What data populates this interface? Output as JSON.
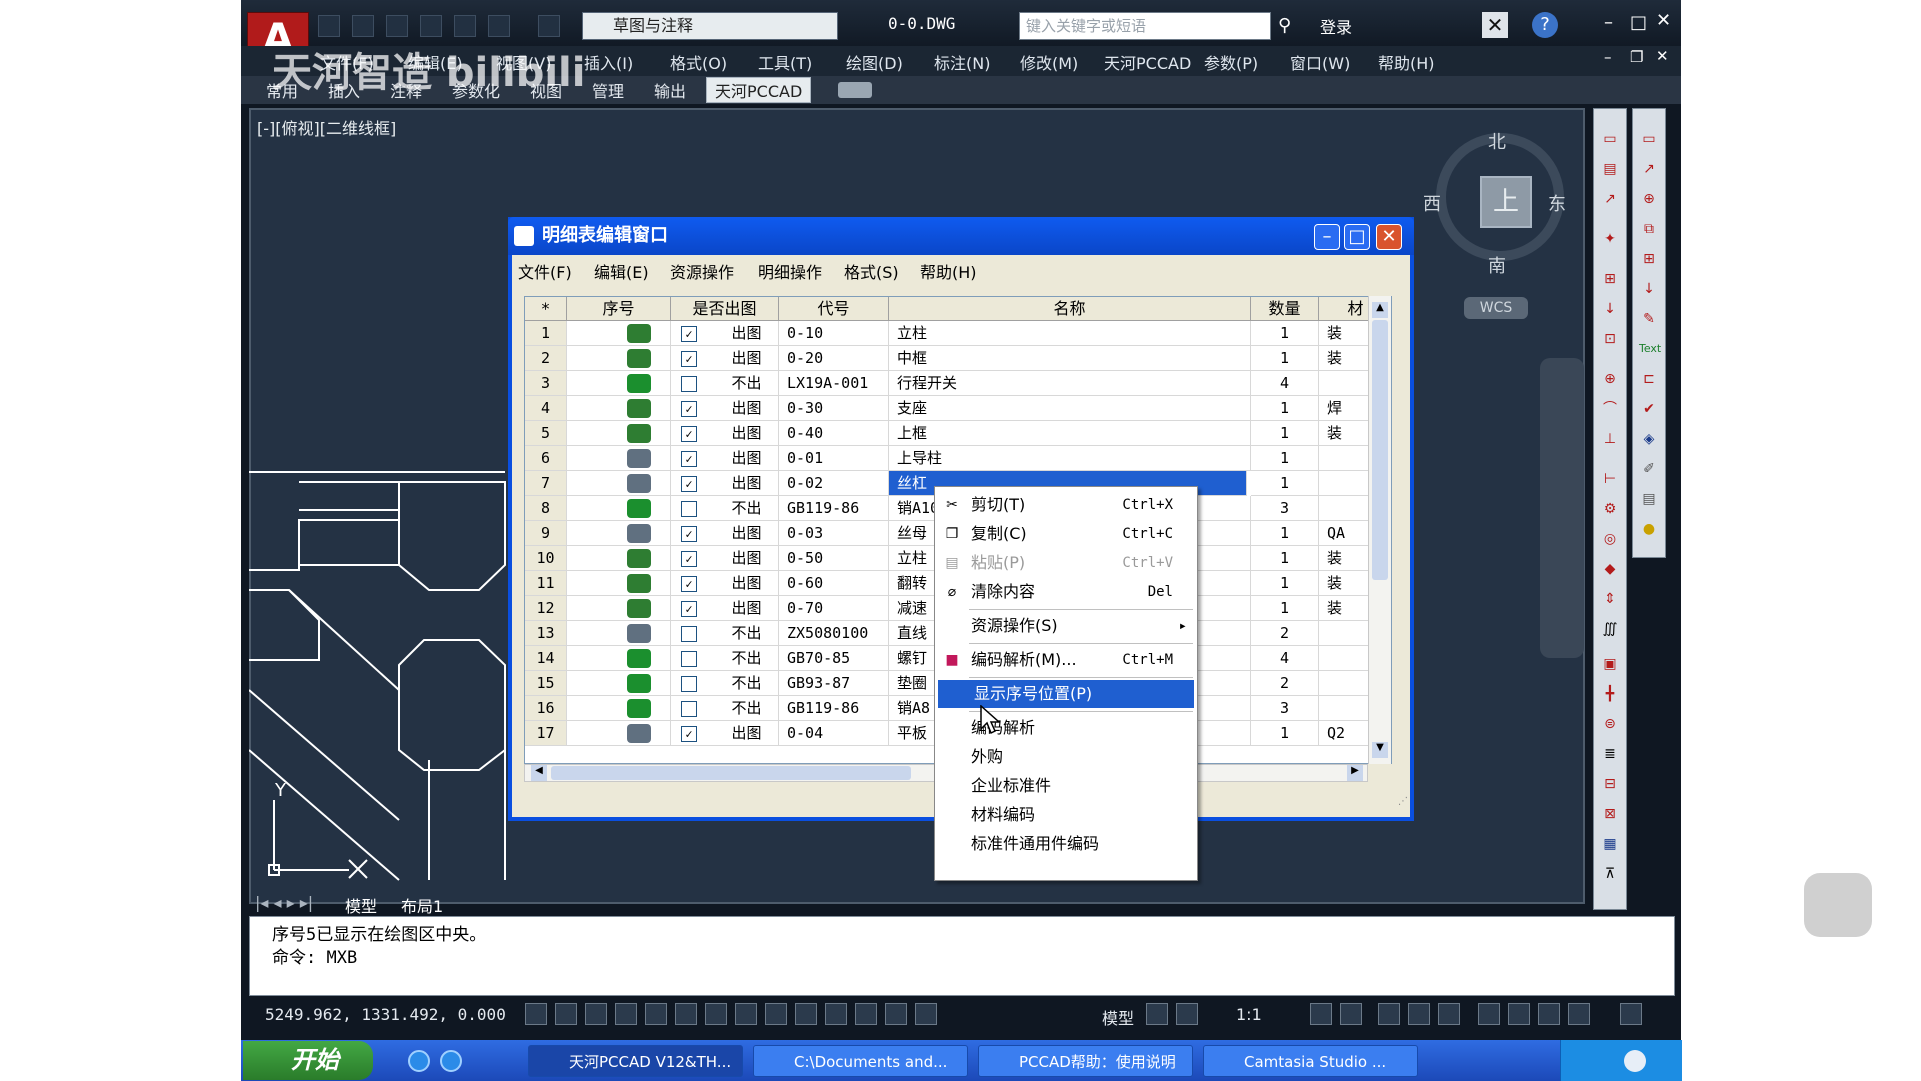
{
  "window": {
    "workspace": "草图与注释",
    "doc_title": "0-0.DWG",
    "search_placeholder": "键入关键字或短语",
    "login": "登录"
  },
  "menubar": [
    "文件(F)",
    "编辑(E)",
    "视图(V)",
    "插入(I)",
    "格式(O)",
    "工具(T)",
    "绘图(D)",
    "标注(N)",
    "修改(M)",
    "天河PCCAD",
    "参数(P)",
    "窗口(W)",
    "帮助(H)"
  ],
  "ribbon_tabs": [
    "常用",
    "插入",
    "注释",
    "参数化",
    "视图",
    "管理",
    "输出",
    "天河PCCAD"
  ],
  "watermark": "天河智造 bilibili",
  "viewport_label": "[-][俯视][二维线框]",
  "compass": {
    "north": "北",
    "south": "南",
    "east": "东",
    "west": "西",
    "top": "上",
    "wcs": "WCS"
  },
  "layout_tabs": [
    "模型",
    "布局1"
  ],
  "command_lines": [
    "序号5已显示在绘图区中央。",
    "命令: MXB"
  ],
  "status": {
    "coords": "5249.962, 1331.492, 0.000",
    "mode": "模型",
    "scale": "1:1"
  },
  "taskbar": {
    "start": "开始",
    "tasks": [
      "天河PCCAD V12&TH...",
      "C:\\Documents and...",
      "PCCAD帮助：使用说明",
      "Camtasia Studio ..."
    ]
  },
  "dialog": {
    "title": "明细表编辑窗口",
    "menu": [
      "文件(F)",
      "编辑(E)",
      "资源操作",
      "明细操作",
      "格式(S)",
      "帮助(H)"
    ],
    "columns": [
      "*",
      "序号",
      "是否出图",
      "代号",
      "名称",
      "数量",
      "材"
    ],
    "rows": [
      {
        "i": "1",
        "no": "1",
        "checked": true,
        "out": "出图",
        "code": "0-10",
        "name": "立柱",
        "qty": "1",
        "mat": "装",
        "icon": "#2e7d32"
      },
      {
        "i": "2",
        "no": "2",
        "checked": true,
        "out": "出图",
        "code": "0-20",
        "name": "中框",
        "qty": "1",
        "mat": "装",
        "icon": "#2e7d32"
      },
      {
        "i": "3",
        "no": "3",
        "checked": false,
        "out": "不出",
        "code": "LX19A-001",
        "name": "行程开关",
        "qty": "4",
        "mat": "",
        "icon": "#1b8f2e"
      },
      {
        "i": "4",
        "no": "4",
        "checked": true,
        "out": "出图",
        "code": "0-30",
        "name": "支座",
        "qty": "1",
        "mat": "焊",
        "icon": "#2e7d32"
      },
      {
        "i": "5",
        "no": "5",
        "checked": true,
        "out": "出图",
        "code": "0-40",
        "name": "上框",
        "qty": "1",
        "mat": "装",
        "icon": "#2e7d32"
      },
      {
        "i": "6",
        "no": "6",
        "checked": true,
        "out": "出图",
        "code": "0-01",
        "name": "上导柱",
        "qty": "1",
        "mat": "",
        "icon": "#607080"
      },
      {
        "i": "7",
        "no": "7",
        "checked": true,
        "out": "出图",
        "code": "0-02",
        "name": "丝杠",
        "qty": "1",
        "mat": "",
        "icon": "#607080"
      },
      {
        "i": "8",
        "no": "8",
        "checked": false,
        "out": "不出",
        "code": "GB119-86",
        "name": "销A10",
        "qty": "3",
        "mat": "",
        "icon": "#1b8f2e"
      },
      {
        "i": "9",
        "no": "9",
        "checked": true,
        "out": "出图",
        "code": "0-03",
        "name": "丝母",
        "qty": "1",
        "mat": "QA",
        "icon": "#607080"
      },
      {
        "i": "10",
        "no": "10",
        "checked": true,
        "out": "出图",
        "code": "0-50",
        "name": "立柱",
        "qty": "1",
        "mat": "装",
        "icon": "#2e7d32"
      },
      {
        "i": "11",
        "no": "11",
        "checked": true,
        "out": "出图",
        "code": "0-60",
        "name": "翻转",
        "qty": "1",
        "mat": "装",
        "icon": "#2e7d32"
      },
      {
        "i": "12",
        "no": "12",
        "checked": true,
        "out": "出图",
        "code": "0-70",
        "name": "减速",
        "qty": "1",
        "mat": "装",
        "icon": "#2e7d32"
      },
      {
        "i": "13",
        "no": "13",
        "checked": false,
        "out": "不出",
        "code": "ZX5080100",
        "name": "直线",
        "qty": "2",
        "mat": "",
        "icon": "#607080"
      },
      {
        "i": "14",
        "no": "14",
        "checked": false,
        "out": "不出",
        "code": "GB70-85",
        "name": "螺钉",
        "qty": "4",
        "mat": "",
        "icon": "#1b8f2e"
      },
      {
        "i": "15",
        "no": "15",
        "checked": false,
        "out": "不出",
        "code": "GB93-87",
        "name": "垫圈",
        "qty": "2",
        "mat": "",
        "icon": "#1b8f2e"
      },
      {
        "i": "16",
        "no": "16",
        "checked": false,
        "out": "不出",
        "code": "GB119-86",
        "name": "销A8",
        "qty": "3",
        "mat": "",
        "icon": "#1b8f2e"
      },
      {
        "i": "17",
        "no": "17",
        "checked": true,
        "out": "出图",
        "code": "0-04",
        "name": "平板",
        "qty": "1",
        "mat": "Q2",
        "icon": "#607080"
      }
    ]
  },
  "context_menu": [
    {
      "label": "剪切(T)",
      "shortcut": "Ctrl+X",
      "icon": "✂"
    },
    {
      "label": "复制(C)",
      "shortcut": "Ctrl+C",
      "icon": "❐"
    },
    {
      "label": "粘贴(P)",
      "shortcut": "Ctrl+V",
      "icon": "▤",
      "disabled": true
    },
    {
      "label": "清除内容",
      "shortcut": "Del",
      "icon": "⌀"
    },
    {
      "sep": true
    },
    {
      "label": "资源操作(S)",
      "submenu": true
    },
    {
      "sep": true
    },
    {
      "label": "编码解析(M)...",
      "shortcut": "Ctrl+M",
      "icon": "■"
    },
    {
      "sep": true
    },
    {
      "label": "显示序号位置(P)",
      "selected": true
    },
    {
      "sep": true
    },
    {
      "label": "编码解析"
    },
    {
      "label": "外购"
    },
    {
      "label": "企业标准件"
    },
    {
      "label": "材料编码"
    },
    {
      "label": "标准件通用件编码"
    }
  ]
}
